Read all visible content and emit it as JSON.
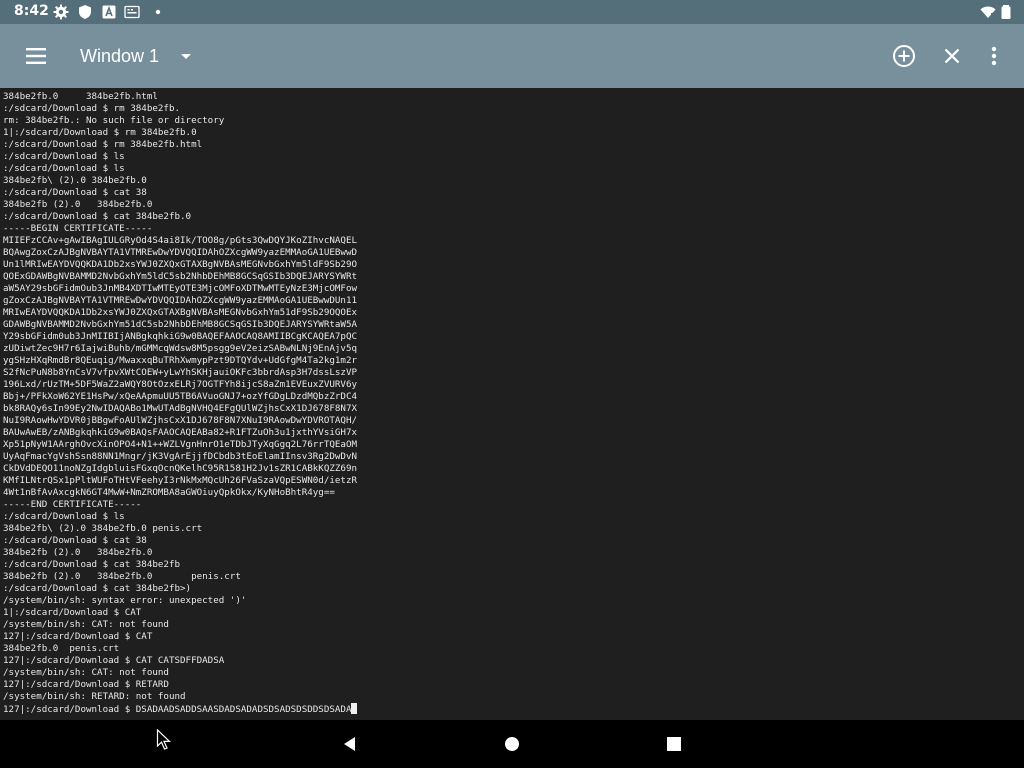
{
  "status_bar": {
    "time": "8:42",
    "left_icons": [
      "gear-icon",
      "shield-icon",
      "font-icon",
      "keyboard-icon",
      "dot-icon"
    ],
    "right_icons": [
      "wifi-icon",
      "battery-icon"
    ]
  },
  "toolbar": {
    "title": "Window 1",
    "actions": [
      "add-window-icon",
      "close-icon",
      "more-vert-icon"
    ]
  },
  "terminal": {
    "background": "#1f1f1f",
    "foreground": "#e8e8e8",
    "lines": [
      "384be2fb.0     384be2fb.html",
      ":/sdcard/Download $ rm 384be2fb.",
      "rm: 384be2fb.: No such file or directory",
      "1|:/sdcard/Download $ rm 384be2fb.0",
      ":/sdcard/Download $ rm 384be2fb.html",
      ":/sdcard/Download $ ls",
      ":/sdcard/Download $ ls",
      "384be2fb\\ (2).0 384be2fb.0",
      ":/sdcard/Download $ cat 38",
      "384be2fb (2).0   384be2fb.0",
      ":/sdcard/Download $ cat 384be2fb.0",
      "-----BEGIN CERTIFICATE-----",
      "MIIEFzCCAv+gAwIBAgIULGRyOd4S4ai8Ik/TOO8g/pGts3QwDQYJKoZIhvcNAQEL",
      "BQAwgZoxCzAJBgNVBAYTA1VTMREwDwYDVQQIDAhOZXcgWW9yazEMMAoGA1UEBwwD",
      "Un1lMRIwEAYDVQQKDA1Db2xsYWJ0ZXQxGTAXBgNVBAsMEGNvbGxhYm5ldF9Sb29O",
      "QOExGDAWBgNVBAMMD2NvbGxhYm5ldC5sb2NhbDEhMB8GCSqGSIb3DQEJARYSYWRt",
      "aW5AY29sbGFidmOub3JnMB4XDTIwMTEyOTE3MjcOMFoXDTMwMTEyNzE3MjcOMFow",
      "gZoxCzAJBgNVBAYTA1VTMREwDwYDVQQIDAhOZXcgWW9yazEMMAoGA1UEBwwDUn11",
      "MRIwEAYDVQQKDA1Db2xsYWJ0ZXQxGTAXBgNVBAsMEGNvbGxhYm51dF9Sb29OQOEx",
      "GDAWBgNVBAMMD2NvbGxhYm51dC5sb2NhbDEhMB8GCSqGSIb3DQEJARYSYWRtaW5A",
      "Y29sbGFidm0ub3JnMIIBIjANBgkqhkiG9w0BAQEFAAOCAQ8AMIIBCgKCAQEA7pQC",
      "zUDiwtZec9H7r6IajwiBuhb/mGMMcqWdsw8M5psgg9eV2eizSABwNLNj9EnAjv5q",
      "ygSHzHXqRmdBr8QEuqig/MwaxxqBuTRhXwmypPzt9DTQYdv+UdGfgM4Ta2kg1m2r",
      "S2fNcPuN8b8YnCsV7vfpvXWtCOEW+yLwYhSKHjauiOKFc3bbrdAsp3H7dssLszVP",
      "196Lxd/rUzTM+5DF5WaZ2aWQY8OtOzxELRj7OGTFYh8ijcS8aZm1EVEuxZVURV6y",
      "Bbj+/PFkXoW62YE1HsPw/xQeAApmuUU5TB6AVuoGNJ7+ozYfGDgLDzdMQbzZrDC4",
      "bk8RAQy6sIn99Ey2NwIDAQABo1MwUTAdBgNVHQ4EFgQUlWZjhsCxX1DJ678F8N7X",
      "NuI9RAowHwYDVR0jBBgwFoAUlWZjhsCxX1DJ678F8N7XNuI9RAowDwYDVROTAQH/",
      "BAUwAwEB/zANBgkqhkiG9w0BAQsFAAOCAQEABa82+R1FTZuOh3u1jxthYVsiGH7x",
      "Xp51pNyW1AArghOvcXinOPO4+N1++WZLVgnHnrO1eTDbJTyXqGgq2L76rrTQEaOM",
      "UyAqFmacYgVshSsn88NN1Mngr/jK3VgArEjjfDCbdb3tEoElamIInsv3Rg2DwDvN",
      "CkDVdDEQO11noNZgIdgbluisFGxqOcnQKelhC95R1581H2Jv1sZR1CABkKQZZ69n",
      "KMfILNtrQSx1pPltWUFoTHtVFeehyI3rNkMxMQcUh26FVaSzaVQpESWN0d/ietzR",
      "4Wt1nBfAvAxcgkN6GT4MwW+NmZROMBA8aGWOiuyQpkOkx/KyNHoBhtR4yg==",
      "-----END CERTIFICATE-----",
      ":/sdcard/Download $ ls",
      "384be2fb\\ (2).0 384be2fb.0 penis.crt",
      ":/sdcard/Download $ cat 38",
      "384be2fb (2).0   384be2fb.0",
      ":/sdcard/Download $ cat 384be2fb",
      "384be2fb (2).0   384be2fb.0       penis.crt",
      ":/sdcard/Download $ cat 384be2fb>)",
      "/system/bin/sh: syntax error: unexpected ')'",
      "1|:/sdcard/Download $ CAT",
      "/system/bin/sh: CAT: not found",
      "127|:/sdcard/Download $ CAT",
      "384be2fb.0  penis.crt",
      "127|:/sdcard/Download $ CAT CATSDFFDADSA",
      "/system/bin/sh: CAT: not found",
      "127|:/sdcard/Download $ RETARD",
      "/system/bin/sh: RETARD: not found",
      "127|:/sdcard/Download $ DSADAADSADDSAASDADSADADSDSADSDSDDSDSADA"
    ]
  },
  "nav_bar": {
    "buttons": [
      "back-icon",
      "home-icon",
      "recents-icon"
    ]
  }
}
